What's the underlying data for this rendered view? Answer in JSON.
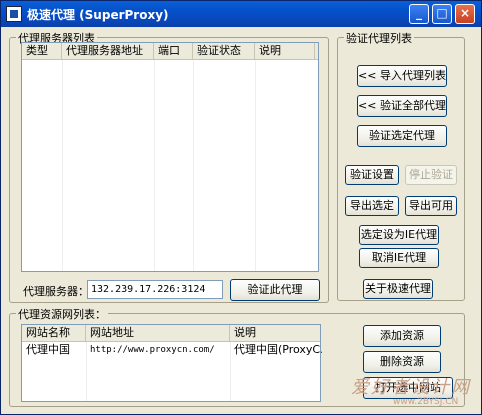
{
  "window": {
    "title": "极速代理 (SuperProxy)",
    "controls": {
      "minimize": "_",
      "maximize": "□",
      "close": "×"
    }
  },
  "proxy_group": {
    "label": "代理服务器列表",
    "columns": [
      "类型",
      "代理服务器地址",
      "端口",
      "验证状态",
      "说明"
    ],
    "server_label": "代理服务器：",
    "server_value": "132.239.17.226:3124",
    "verify_this_button": "验证此代理"
  },
  "verify_group": {
    "label": "验证代理列表",
    "import_button": "<< 导入代理列表",
    "verify_all_button": "<< 验证全部代理",
    "verify_selected_button": "验证选定代理",
    "verify_settings_button": "验证设置",
    "stop_verify_button": "停止验证",
    "export_selected_button": "导出选定",
    "export_available_button": "导出可用",
    "set_ie_proxy_button": "选定设为IE代理",
    "cancel_ie_proxy_button": "取消IE代理",
    "about_button": "关于极速代理"
  },
  "resource_group": {
    "label": "代理资源网列表：",
    "columns": [
      "网站名称",
      "网站地址",
      "说明"
    ],
    "rows": [
      {
        "name": "代理中国",
        "url": "http://www.proxycn.com/",
        "desc": "代理中国(ProxyC..."
      }
    ],
    "add_button": "添加资源",
    "delete_button": "删除资源",
    "open_button": "打开选中网站"
  },
  "watermark": {
    "text1": "爱好者设计网",
    "text2": "www.2BYSJ.CN"
  },
  "colors": {
    "titlebar": "#0a50c8",
    "face": "#ece9d8",
    "border": "#7f9db9"
  }
}
